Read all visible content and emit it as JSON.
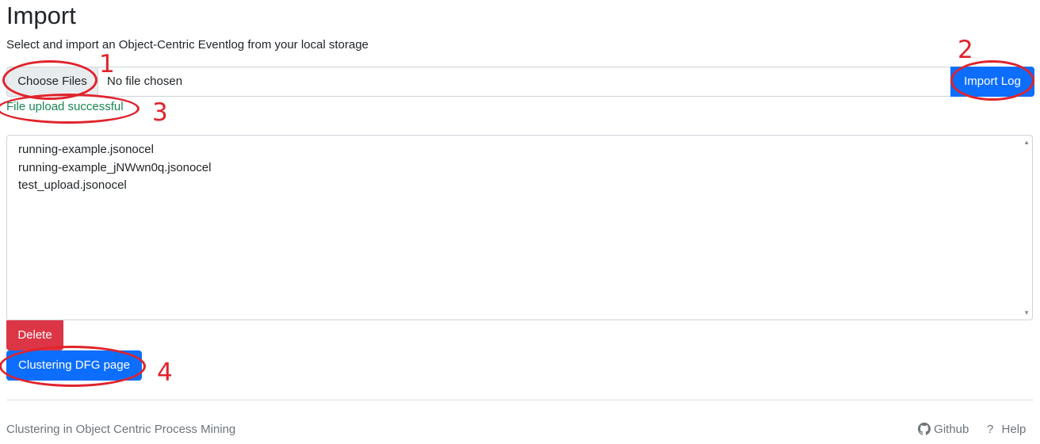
{
  "page": {
    "title": "Import",
    "subtitle": "Select and import an Object-Centric Eventlog from your local storage"
  },
  "upload": {
    "choose_label": "Choose Files",
    "file_status": "No file chosen",
    "import_label": "Import Log",
    "success_message": "File upload successful"
  },
  "file_list": {
    "items": [
      "running-example.jsonocel",
      "running-example_jNWwn0q.jsonocel",
      "test_upload.jsonocel"
    ]
  },
  "actions": {
    "delete_label": "Delete",
    "clustering_label": "Clustering DFG page"
  },
  "footer": {
    "text": "Clustering in Object Centric Process Mining",
    "github_label": "Github",
    "help_label": "Help",
    "help_icon": "?"
  },
  "annotations": [
    "1",
    "2",
    "3",
    "4"
  ],
  "colors": {
    "primary": "#0d6efd",
    "danger": "#dc3545",
    "success": "#198754",
    "annotation": "#e0232b"
  }
}
